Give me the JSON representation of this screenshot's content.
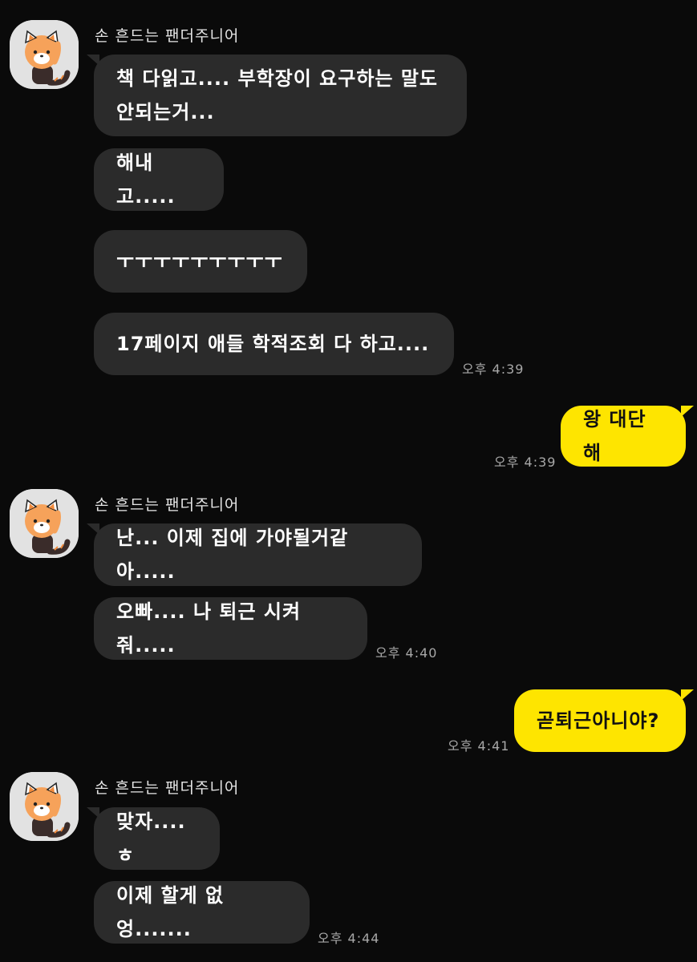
{
  "groups": [
    {
      "sender": "손 흔드는 팬더주니어",
      "avatar": "red-panda-sticker-avatar",
      "messages": [
        "책 다읽고.... 부학장이 요구하는 말도 안되는거...",
        "해내고.....",
        "ㅜㅜㅜㅜㅜㅜㅜㅜㅜ",
        "17페이지 애들 학적조회 다 하고...."
      ],
      "time": "오후 4:39"
    },
    {
      "outgoing": true,
      "messages": [
        "왕 대단해"
      ],
      "time": "오후 4:39"
    },
    {
      "sender": "손 흔드는 팬더주니어",
      "avatar": "red-panda-sticker-avatar",
      "messages": [
        "난... 이제 집에 가야될거같아.....",
        "오빠.... 나 퇴근 시켜줘....."
      ],
      "time": "오후 4:40"
    },
    {
      "outgoing": true,
      "messages": [
        "곧퇴근아니야?"
      ],
      "time": "오후 4:41"
    },
    {
      "sender": "손 흔드는 팬더주니어",
      "avatar": "red-panda-sticker-avatar",
      "messages": [
        "맞자.... ㅎ",
        "이제 할게 없엉......."
      ],
      "time": "오후 4:44"
    }
  ],
  "colors": {
    "background": "#0a0a0a",
    "incoming_bubble": "#2b2b2b",
    "outgoing_bubble": "#fee500",
    "timestamp": "#a8a8a8"
  }
}
